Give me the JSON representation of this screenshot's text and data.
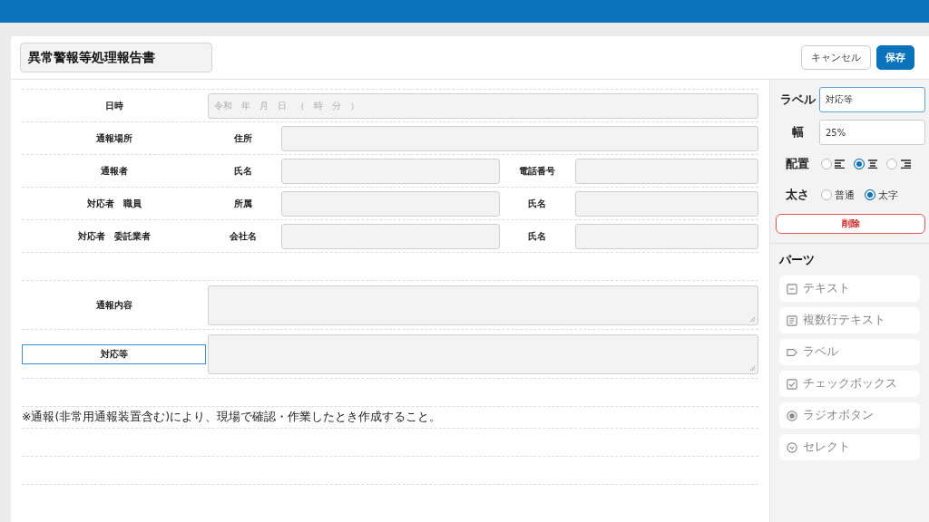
{
  "header": {
    "title": "異常警報等処理報告書",
    "buttons": [
      {
        "kind": "secondary",
        "label": "キャンセル"
      },
      {
        "kind": "primary",
        "label": "保存"
      }
    ]
  },
  "form": {
    "rows": [
      {
        "kind": "date",
        "label": "日時",
        "selected": false,
        "placeholder": "令和　年　月　日　（　時　分　）"
      },
      {
        "kind": "single",
        "label": "通報場所",
        "selected": false,
        "sublabel": "住所"
      },
      {
        "kind": "pair",
        "label": "通報者",
        "selected": false,
        "sublabel": "氏名",
        "sublabel2": "電話番号"
      },
      {
        "kind": "pair",
        "label": "対応者　職員",
        "selected": false,
        "sublabel": "所属",
        "sublabel2": "氏名"
      },
      {
        "kind": "pair",
        "label": "対応者　委託業者",
        "selected": false,
        "sublabel": "会社名",
        "sublabel2": "氏名"
      },
      {
        "kind": "blank"
      },
      {
        "kind": "textarea",
        "label": "通報内容",
        "selected": false
      },
      {
        "kind": "textarea",
        "label": "対応等",
        "selected": true
      },
      {
        "kind": "blank"
      },
      {
        "kind": "note",
        "text": "※通報(非常用通報装置含む)により、現場で確認・作業したとき作成すること。"
      },
      {
        "kind": "blank"
      },
      {
        "kind": "blank"
      }
    ]
  },
  "properties": {
    "label_caption": "ラベル",
    "label_value": "対応等",
    "width_caption": "幅",
    "width_value": "25%",
    "align_caption": "配置",
    "align_options": [
      {
        "kind": "left",
        "selected": false
      },
      {
        "kind": "center",
        "selected": true
      },
      {
        "kind": "right",
        "selected": false
      }
    ],
    "weight_caption": "太さ",
    "weight_options": [
      {
        "label": "普通",
        "selected": false
      },
      {
        "label": "太字",
        "selected": true
      }
    ],
    "delete_button": "削除"
  },
  "parts": {
    "title": "パーツ",
    "items": [
      {
        "kind": "text",
        "label": "テキスト"
      },
      {
        "kind": "multiline",
        "label": "複数行テキスト"
      },
      {
        "kind": "label",
        "label": "ラベル"
      },
      {
        "kind": "checkbox",
        "label": "チェックボックス"
      },
      {
        "kind": "radio",
        "label": "ラジオボタン"
      },
      {
        "kind": "select",
        "label": "セレクト"
      }
    ]
  }
}
